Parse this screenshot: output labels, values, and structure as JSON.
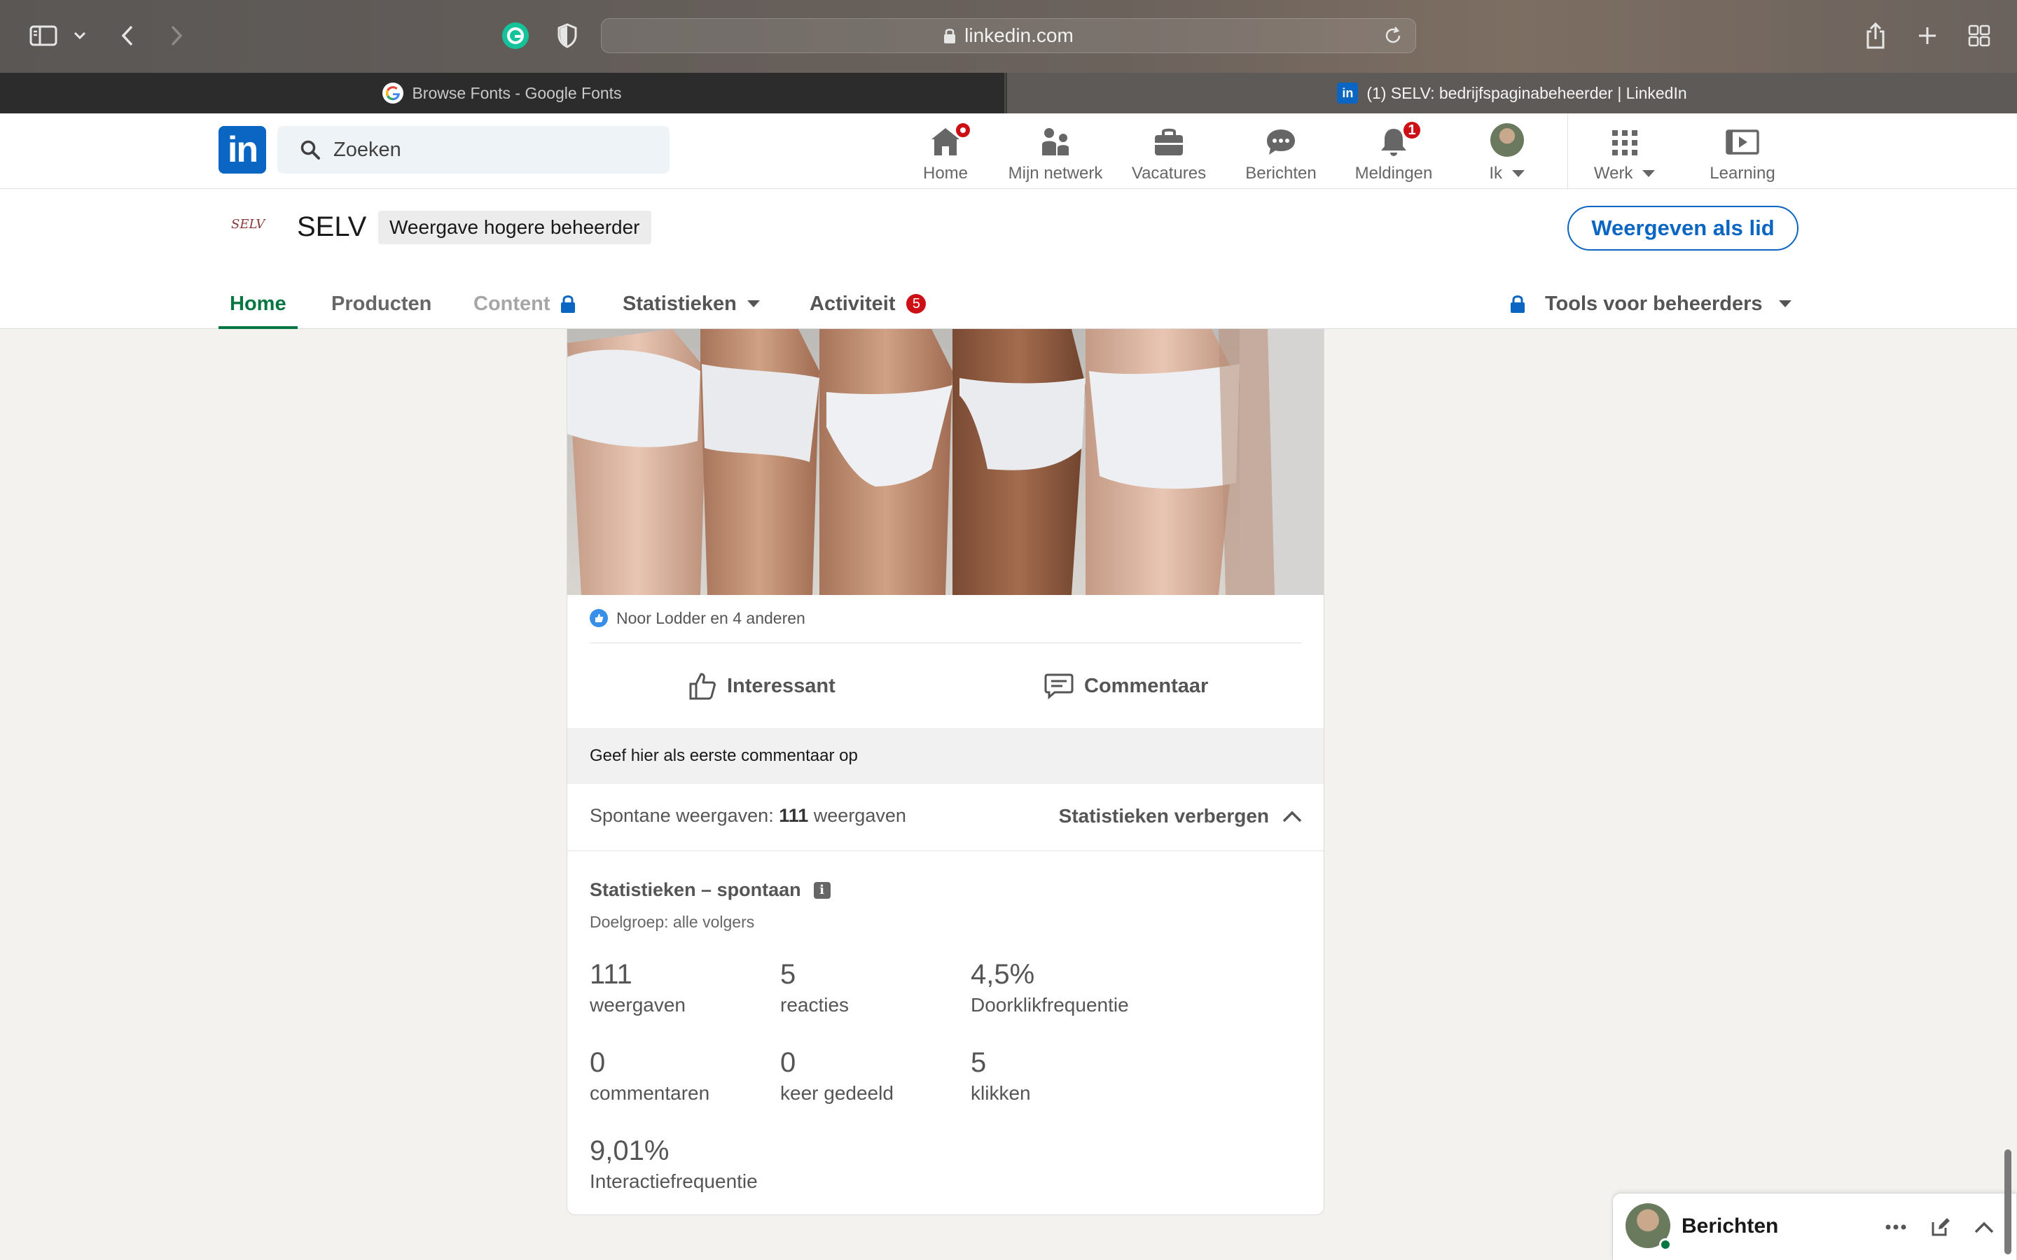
{
  "browser": {
    "address": "linkedin.com",
    "tabs": [
      {
        "title": "Browse Fonts - Google Fonts",
        "active": false
      },
      {
        "title": "(1) SELV: bedrijfspaginabeheerder | LinkedIn",
        "active": true
      }
    ]
  },
  "linkedin_nav": {
    "logo": "in",
    "search_placeholder": "Zoeken",
    "items": [
      {
        "label": "Home",
        "icon": "home-icon",
        "badge": "dot"
      },
      {
        "label": "Mijn netwerk",
        "icon": "network-icon"
      },
      {
        "label": "Vacatures",
        "icon": "briefcase-icon"
      },
      {
        "label": "Berichten",
        "icon": "messaging-icon"
      },
      {
        "label": "Meldingen",
        "icon": "bell-icon",
        "badge": "1"
      },
      {
        "label": "Ik",
        "icon": "avatar"
      },
      {
        "label": "Werk",
        "icon": "grid-icon"
      },
      {
        "label": "Learning",
        "icon": "learning-icon"
      }
    ]
  },
  "company": {
    "logo_text": "SELV",
    "name": "SELV",
    "view_badge": "Weergave hogere beheerder",
    "member_view_button": "Weergeven als lid",
    "tabs": {
      "home": "Home",
      "products": "Producten",
      "content": "Content",
      "stats": "Statistieken",
      "activity": "Activiteit",
      "activity_badge": "5",
      "admin_tools": "Tools voor beheerders"
    }
  },
  "post": {
    "social_counts": "Noor Lodder en 4 anderen",
    "actions": {
      "like": "Interessant",
      "comment": "Commentaar"
    },
    "comment_prompt": "Geef hier als eerste commentaar op",
    "impressions_prefix": "Spontane weergaven: ",
    "impressions_value": "111",
    "impressions_suffix": " weergaven",
    "hide_stats": "Statistieken verbergen",
    "stats": {
      "title": "Statistieken – spontaan",
      "audience": "Doelgroep: alle volgers",
      "items": [
        {
          "value": "111",
          "label": "weergaven"
        },
        {
          "value": "5",
          "label": "reacties"
        },
        {
          "value": "4,5%",
          "label": "Doorklikfrequentie"
        },
        {
          "value": "0",
          "label": "commentaren"
        },
        {
          "value": "0",
          "label": "keer gedeeld"
        },
        {
          "value": "5",
          "label": "klikken"
        },
        {
          "value": "9,01%",
          "label": "Interactiefrequentie"
        }
      ]
    }
  },
  "messaging": {
    "title": "Berichten"
  },
  "colors": {
    "linkedin_blue": "#0a66c2",
    "active_green": "#057642",
    "badge_red": "#cc1016"
  }
}
